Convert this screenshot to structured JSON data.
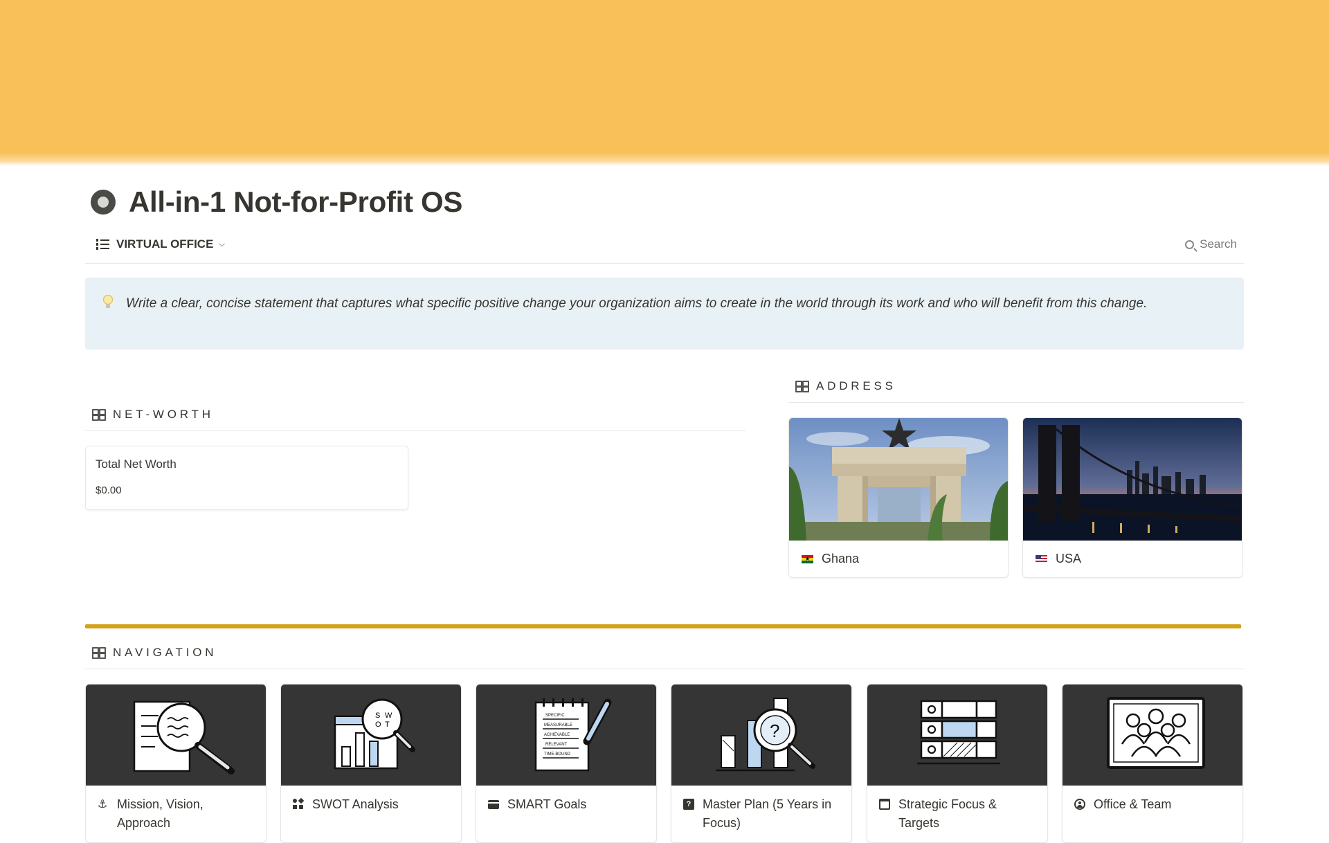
{
  "page": {
    "title": "All-in-1 Not-for-Profit OS",
    "cover_color": "#f9c05a",
    "icon": "target-circle-icon"
  },
  "view_bar": {
    "view_label": "VIRTUAL OFFICE",
    "search_label": "Search"
  },
  "callout": {
    "icon": "lightbulb-icon",
    "text": "Write a clear, concise statement that captures what specific positive change your organization aims to create in the world through its work and who will benefit from this change."
  },
  "net_worth": {
    "heading": "NET-WORTH",
    "card_label": "Total Net Worth",
    "card_value": "$0.00"
  },
  "address": {
    "heading": "ADDRESS",
    "cards": [
      {
        "label": "Ghana",
        "flag": "ghana-flag-icon"
      },
      {
        "label": "USA",
        "flag": "usa-flag-icon"
      }
    ]
  },
  "divider_color": "#d4a11a",
  "navigation": {
    "heading": "NAVIGATION",
    "cards": [
      {
        "label": "Mission, Vision, Approach",
        "icon": "anchor-icon"
      },
      {
        "label": "SWOT Analysis",
        "icon": "swot-shapes-icon"
      },
      {
        "label": "SMART Goals",
        "icon": "card-icon"
      },
      {
        "label": "Master Plan (5 Years in Focus)",
        "icon": "question-square-icon"
      },
      {
        "label": "Strategic Focus & Targets",
        "icon": "calendar-icon"
      },
      {
        "label": "Office & Team",
        "icon": "user-circle-icon"
      }
    ],
    "swot_letters": [
      "S",
      "W",
      "O",
      "T"
    ],
    "smart_lines": [
      "SPECIFIC",
      "MEASURABLE",
      "ACHIEVABLE",
      "RELEVANT",
      "TIME-BOUND"
    ]
  }
}
